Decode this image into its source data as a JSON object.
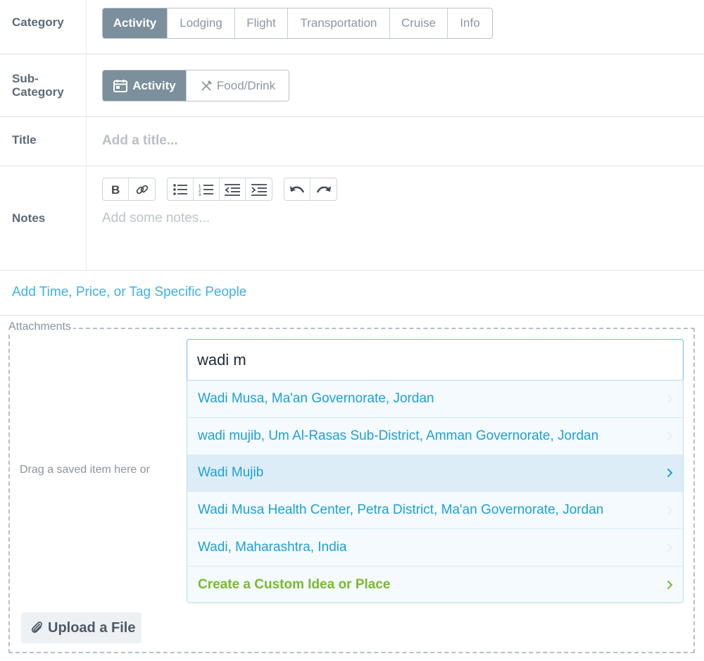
{
  "category": {
    "label": "Category",
    "options": [
      "Activity",
      "Lodging",
      "Flight",
      "Transportation",
      "Cruise",
      "Info"
    ],
    "selected": "Activity"
  },
  "subcategory": {
    "label": "Sub-\nCategory",
    "label_line1": "Sub-",
    "label_line2": "Category",
    "options": [
      {
        "label": "Activity",
        "icon": "calendar-icon"
      },
      {
        "label": "Food/Drink",
        "icon": "utensils-icon"
      }
    ],
    "selected": "Activity"
  },
  "title": {
    "label": "Title",
    "placeholder": "Add a title..."
  },
  "notes": {
    "label": "Notes",
    "placeholder": "Add some notes...",
    "toolbar": {
      "format": [
        "bold-icon",
        "link-icon"
      ],
      "lists": [
        "bulleted-list-icon",
        "numbered-list-icon",
        "outdent-icon",
        "indent-icon"
      ],
      "history": [
        "undo-icon",
        "redo-icon"
      ]
    }
  },
  "add_time_link": "Add Time, Price, or Tag Specific People",
  "attachments": {
    "legend": "Attachments",
    "drag_text": "Drag a saved item here or",
    "search_value": "wadi m",
    "results": [
      "Wadi Musa, Ma'an Governorate, Jordan",
      "wadi mujib, Um Al-Rasas Sub-District, Amman Governorate, Jordan",
      "Wadi Mujib",
      "Wadi Musa Health Center, Petra District, Ma'an Governorate, Jordan",
      "Wadi, Maharashtra, India"
    ],
    "highlighted_index": 2,
    "custom_option": "Create a Custom Idea or Place",
    "upload_label": "Upload a File"
  },
  "colors": {
    "accent_blue": "#3fb1e3",
    "active_segment": "#7b8f9c",
    "custom_green": "#7ab82f"
  }
}
